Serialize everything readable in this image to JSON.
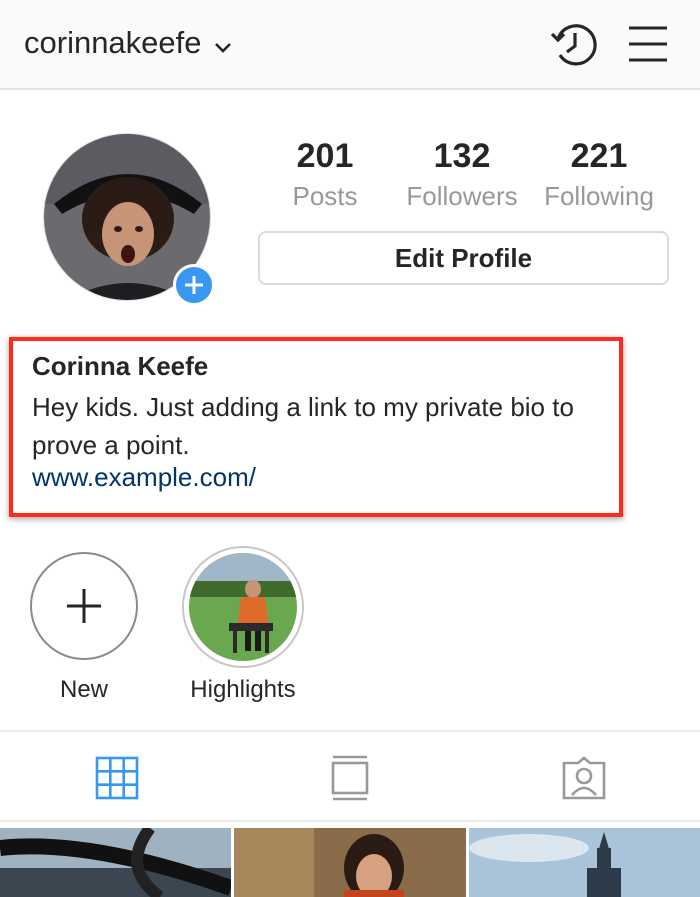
{
  "header": {
    "username": "corinnakeefe",
    "icons": [
      "chevron-down-icon",
      "history-icon",
      "menu-icon"
    ]
  },
  "stats": {
    "posts": {
      "value": "201",
      "label": "Posts"
    },
    "followers": {
      "value": "132",
      "label": "Followers"
    },
    "following": {
      "value": "221",
      "label": "Following"
    }
  },
  "profile": {
    "edit_label": "Edit Profile",
    "name": "Corinna Keefe",
    "bio": "Hey kids. Just adding a link to my private bio to prove a point.",
    "link": "www.example.com/"
  },
  "highlights": [
    {
      "label": "New"
    },
    {
      "label": "Highlights"
    }
  ],
  "tabs": [
    "grid-icon",
    "feed-icon",
    "tagged-icon"
  ],
  "colors": {
    "accent": "#3897f0",
    "link": "#003569",
    "annotation_box": "#ff2a1a"
  }
}
